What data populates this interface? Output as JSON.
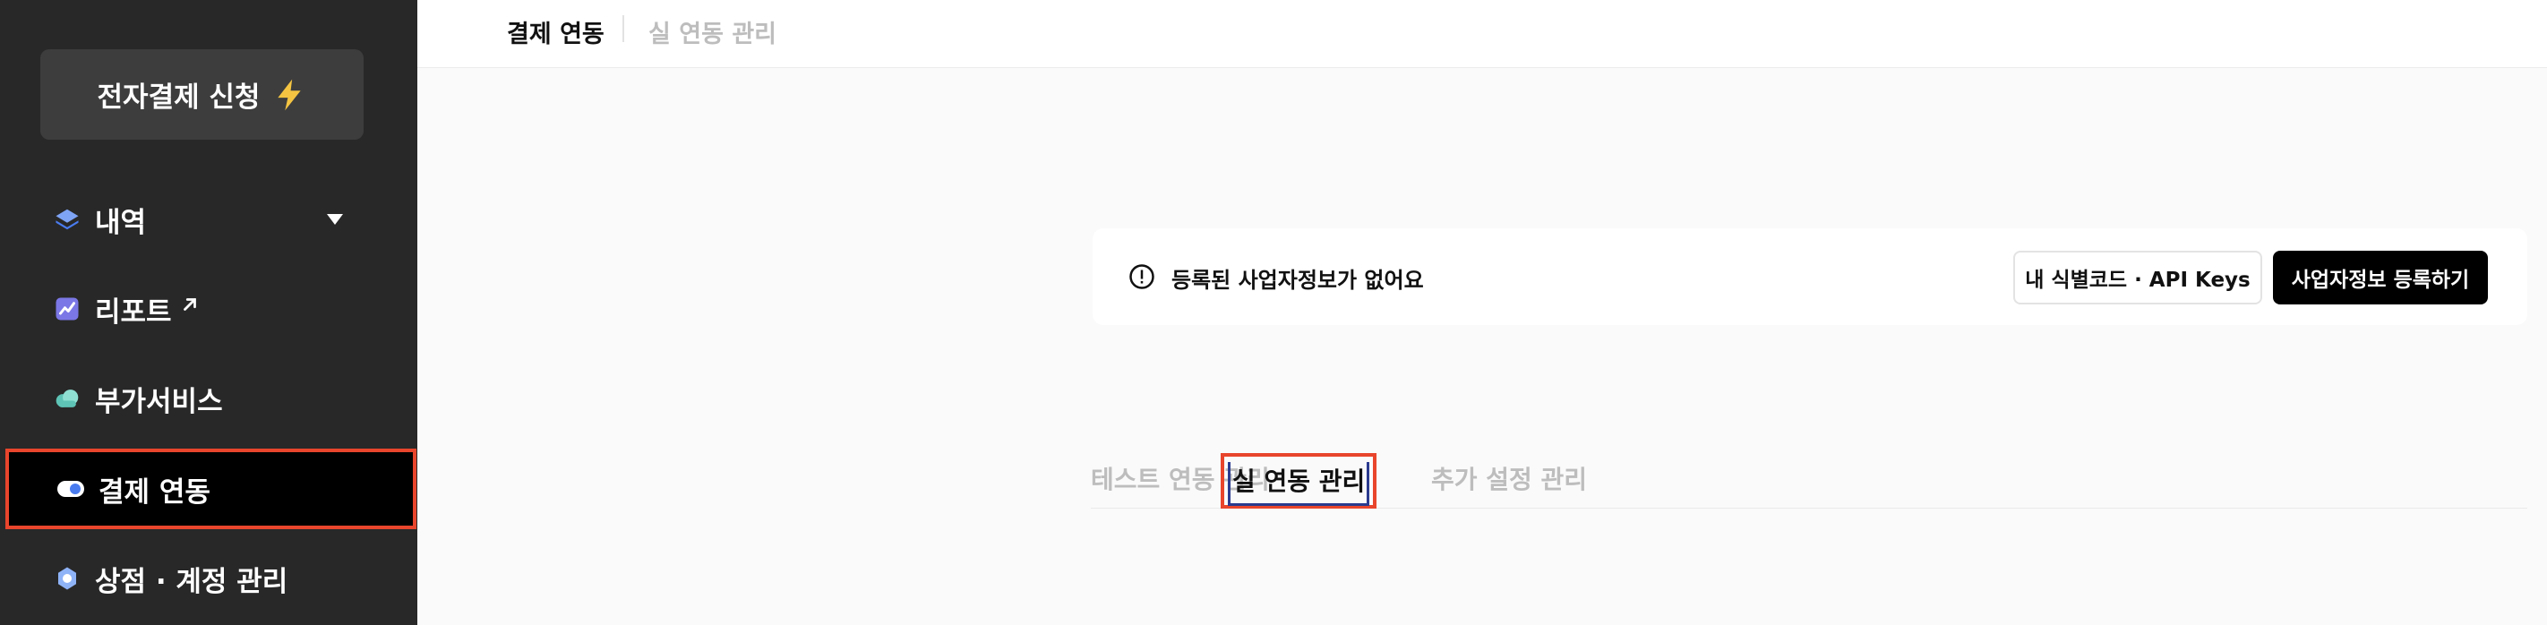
{
  "sidebar": {
    "apply_button": {
      "label": "전자결제 신청",
      "icon": "lightning-icon"
    },
    "items": [
      {
        "label": "내역",
        "icon": "layers-icon",
        "has_dropdown": true
      },
      {
        "label": "리포트",
        "icon": "chart-icon",
        "external": true
      },
      {
        "label": "부가서비스",
        "icon": "cloud-icon"
      },
      {
        "label": "결제 연동",
        "icon": "toggle-icon",
        "active": true
      },
      {
        "label": "상점 · 계정 관리",
        "icon": "store-icon"
      }
    ]
  },
  "header": {
    "tabs": [
      {
        "label": "결제 연동",
        "active": true
      },
      {
        "label": "실 연동 관리",
        "active": false
      }
    ]
  },
  "notice": {
    "message": "등록된 사업자정보가 없어요",
    "icon": "info-icon",
    "secondary_button": "내 식별코드 · API Keys",
    "primary_button": "사업자정보 등록하기"
  },
  "subtabs": [
    {
      "label": "테스트 연동 관리",
      "active": false
    },
    {
      "label": "실 연동 관리",
      "active": true
    },
    {
      "label": "추가 설정 관리",
      "active": false
    }
  ],
  "colors": {
    "sidebar_bg": "#282828",
    "active_outline": "#e8452c",
    "accent_blue": "#4a7cf0",
    "bolt_yellow": "#f5c542"
  }
}
